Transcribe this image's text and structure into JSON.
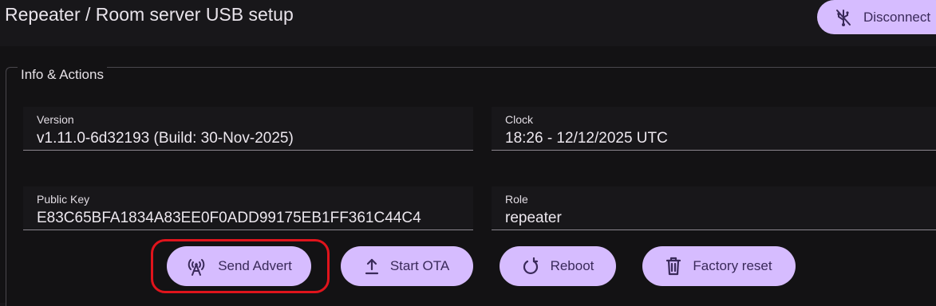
{
  "header": {
    "title": "Repeater / Room server USB setup",
    "disconnect_label": "Disconnect",
    "disconnect_icon": "usb-off-icon"
  },
  "card": {
    "legend": "Info & Actions",
    "fields": {
      "version": {
        "label": "Version",
        "value": "v1.11.0-6d32193 (Build: 30-Nov-2025)"
      },
      "clock": {
        "label": "Clock",
        "value": "18:26 - 12/12/2025 UTC"
      },
      "public_key": {
        "label": "Public Key",
        "value": "E83C65BFA1834A83EE0F0ADD99175EB1FF361C44C4"
      },
      "role": {
        "label": "Role",
        "value": "repeater"
      }
    },
    "actions": {
      "send_advert": {
        "label": "Send Advert",
        "icon": "antenna-icon"
      },
      "start_ota": {
        "label": "Start OTA",
        "icon": "upload-icon"
      },
      "reboot": {
        "label": "Reboot",
        "icon": "restart-icon"
      },
      "factory_reset": {
        "label": "Factory reset",
        "icon": "trash-icon"
      }
    }
  },
  "colors": {
    "accent": "#d6bcff",
    "background": "#131214",
    "highlight": "#e0141c"
  }
}
